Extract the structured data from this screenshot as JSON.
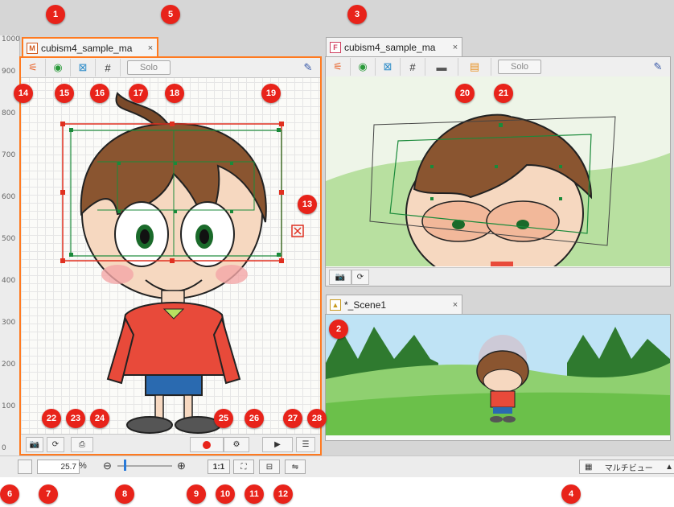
{
  "ruler": {
    "ticks": [
      "1000",
      "900",
      "800",
      "700",
      "600",
      "500",
      "400",
      "300",
      "200",
      "100",
      "0"
    ]
  },
  "model_view": {
    "tab_label": "cubism4_sample_ma",
    "tab_icon": "M",
    "close": "×",
    "solo_label": "Solo"
  },
  "form_view": {
    "tab_label": "cubism4_sample_ma",
    "tab_icon": "F",
    "close": "×",
    "solo_label": "Solo"
  },
  "scene_view": {
    "tab_label": "*_Scene1",
    "close": "×"
  },
  "status": {
    "zoom_value": "25.7",
    "zoom_unit": "%",
    "zoom_minus": "⊖",
    "zoom_plus": "⊕",
    "ratio_label": "1:1",
    "multiview_label": "マルチビュー",
    "multiview_arrow": "▲"
  },
  "markers": [
    "1",
    "2",
    "3",
    "4",
    "5",
    "6",
    "7",
    "8",
    "9",
    "10",
    "11",
    "12",
    "13",
    "14",
    "15",
    "16",
    "17",
    "18",
    "19",
    "20",
    "21",
    "22",
    "23",
    "24",
    "25",
    "26",
    "27",
    "28"
  ],
  "colors": {
    "marker": "#e8231a",
    "accent": "#ff7a20",
    "deformer": "#1a8a3a",
    "selection": "#e03020"
  }
}
